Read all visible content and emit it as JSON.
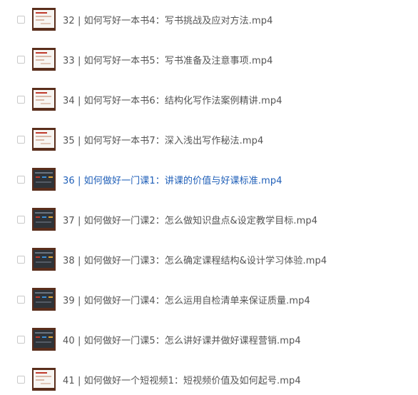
{
  "files": [
    {
      "name": "32 | 如何写好一本书4：写书挑战及应对方法.mp4",
      "thumb": "light",
      "active": false
    },
    {
      "name": "33 | 如何写好一本书5：写书准备及注意事项.mp4",
      "thumb": "light",
      "active": false
    },
    {
      "name": "34 | 如何写好一本书6：结构化写作法案例精讲.mp4",
      "thumb": "light",
      "active": false
    },
    {
      "name": "35 | 如何写好一本书7：深入浅出写作秘法.mp4",
      "thumb": "light",
      "active": false
    },
    {
      "name": "36 | 如何做好一门课1：讲课的价值与好课标准.mp4",
      "thumb": "dark",
      "active": true
    },
    {
      "name": "37 | 如何做好一门课2：怎么做知识盘点&设定教学目标.mp4",
      "thumb": "dark",
      "active": false
    },
    {
      "name": "38 | 如何做好一门课3：怎么确定课程结构&设计学习体验.mp4",
      "thumb": "dark",
      "active": false
    },
    {
      "name": "39 | 如何做好一门课4：怎么运用自检清单来保证质量.mp4",
      "thumb": "dark",
      "active": false
    },
    {
      "name": "40 | 如何做好一门课5：怎么讲好课并做好课程营销.mp4",
      "thumb": "dark",
      "active": false
    },
    {
      "name": "41 | 如何做好一个短视频1：短视频价值及如何起号.mp4",
      "thumb": "light",
      "active": false
    }
  ],
  "colors": {
    "text": "#555555",
    "active_text": "#1f5fb8",
    "thumb_frame": "#5a2e1c"
  }
}
